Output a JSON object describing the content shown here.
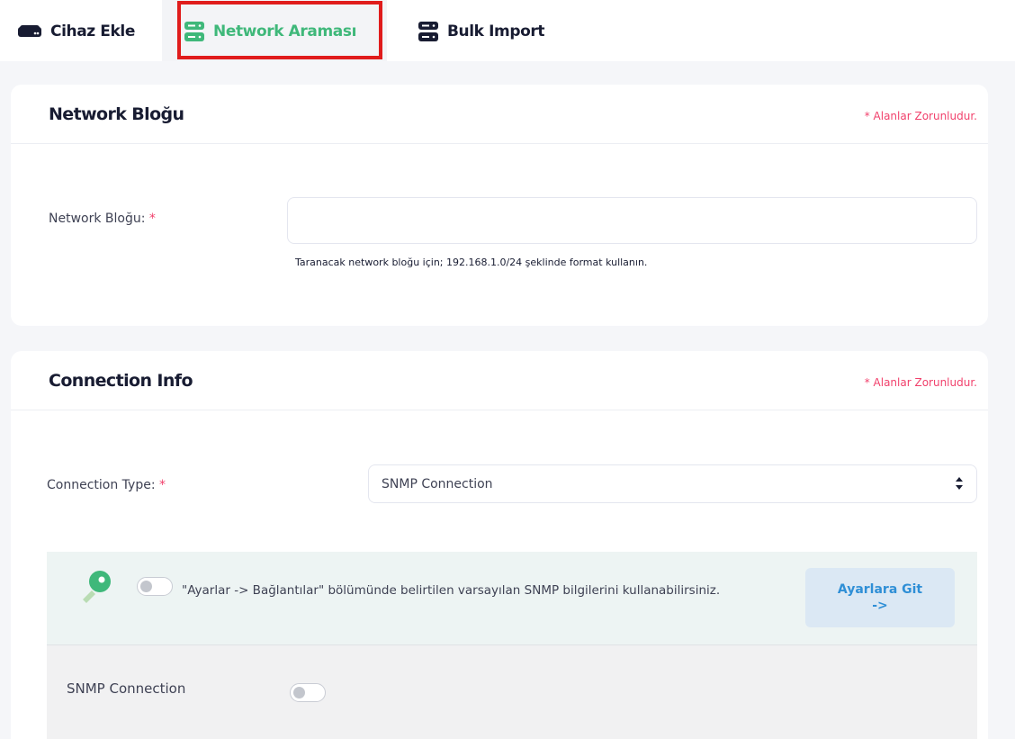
{
  "tabs": [
    {
      "label": "Cihaz Ekle",
      "icon": "device-icon",
      "active": false
    },
    {
      "label": "Network Araması",
      "icon": "server-icon",
      "active": true,
      "highlighted": true
    },
    {
      "label": "Bulk Import",
      "icon": "server-stack-icon",
      "active": false
    }
  ],
  "colors": {
    "accent_green": "#3fb87a",
    "required_red": "#f1416c",
    "highlight_red": "#e01c1c",
    "button_blue": "#2f8fd6"
  },
  "network_block": {
    "title": "Network Bloğu",
    "required_note": "* Alanlar Zorunludur.",
    "label": "Network Bloğu:",
    "required_mark": "*",
    "input_value": "",
    "hint": "Taranacak network bloğu için; 192.168.1.0/24 şeklinde format kullanın."
  },
  "connection_info": {
    "title": "Connection Info",
    "required_note": "* Alanlar Zorunludur.",
    "type_label": "Connection Type:",
    "required_mark": "*",
    "type_selected": "SNMP Connection",
    "info_text": "\"Ayarlar -> Bağlantılar\" bölümünde belirtilen varsayılan SNMP bilgilerini kullanabilirsiniz.",
    "default_toggle_on": false,
    "settings_button_line1": "Ayarlara Git",
    "settings_button_line2": "->",
    "snmp_label": "SNMP Connection",
    "snmp_toggle_on": false
  }
}
